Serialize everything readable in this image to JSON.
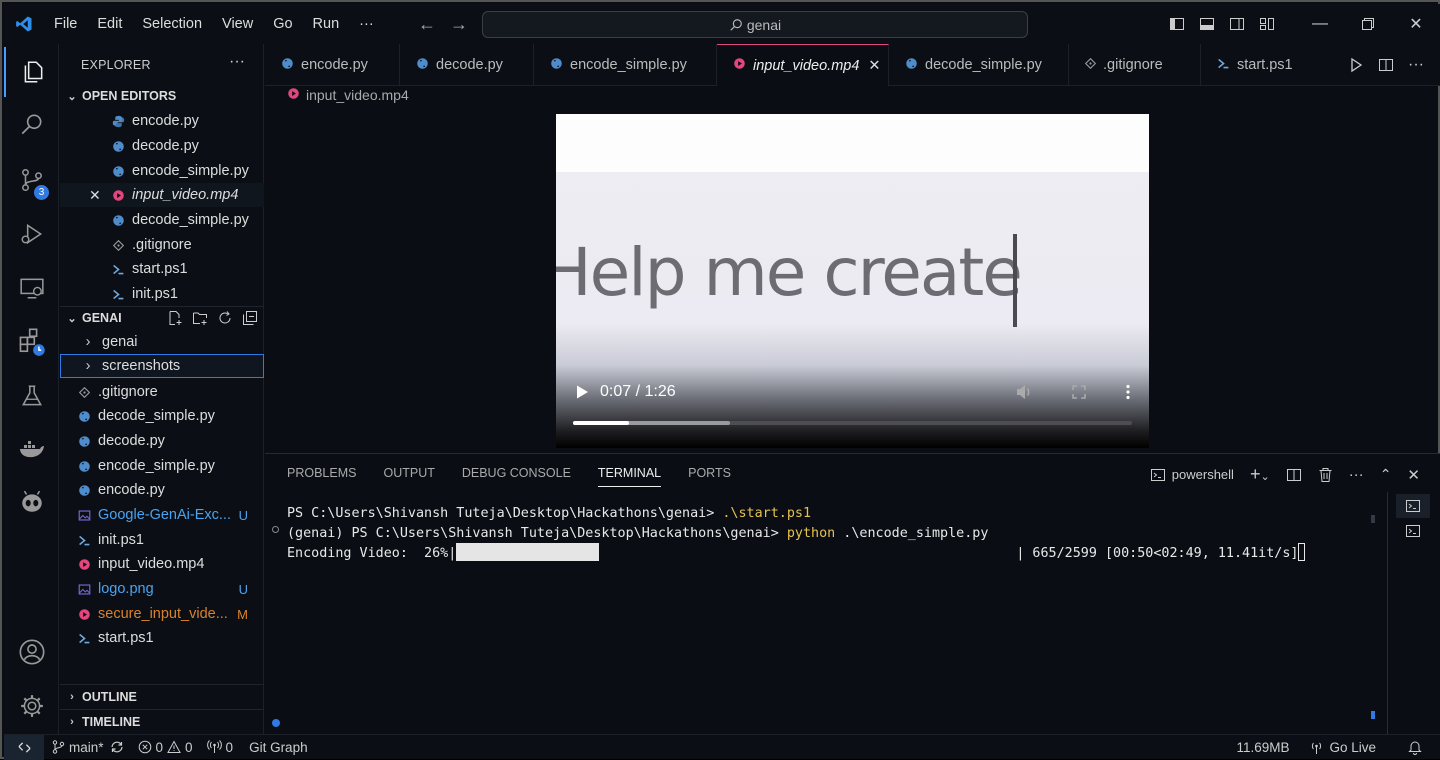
{
  "menu": [
    "File",
    "Edit",
    "Selection",
    "View",
    "Go",
    "Run",
    "···"
  ],
  "search": {
    "text": "genai"
  },
  "sidebar": {
    "title": "EXPLORER",
    "more": "···",
    "open_editors_label": "OPEN EDITORS",
    "open_editors": [
      {
        "name": "encode.py",
        "icon": "python"
      },
      {
        "name": "decode.py",
        "icon": "python"
      },
      {
        "name": "encode_simple.py",
        "icon": "python"
      },
      {
        "name": "input_video.mp4",
        "icon": "video"
      },
      {
        "name": "decode_simple.py",
        "icon": "python"
      },
      {
        "name": ".gitignore",
        "icon": "git"
      },
      {
        "name": "start.ps1",
        "icon": "powershell"
      },
      {
        "name": "init.ps1",
        "icon": "powershell"
      }
    ],
    "folder_label": "GENAI",
    "tree": [
      {
        "name": "genai",
        "type": "folder"
      },
      {
        "name": "screenshots",
        "type": "folder"
      },
      {
        "name": ".gitignore",
        "icon": "git"
      },
      {
        "name": "decode_simple.py",
        "icon": "python"
      },
      {
        "name": "decode.py",
        "icon": "python"
      },
      {
        "name": "encode_simple.py",
        "icon": "python"
      },
      {
        "name": "encode.py",
        "icon": "python"
      },
      {
        "name": "Google-GenAi-Exc...",
        "icon": "image",
        "status": "U"
      },
      {
        "name": "init.ps1",
        "icon": "powershell"
      },
      {
        "name": "input_video.mp4",
        "icon": "video"
      },
      {
        "name": "logo.png",
        "icon": "image",
        "status": "U"
      },
      {
        "name": "secure_input_vide...",
        "icon": "video",
        "status": "M"
      },
      {
        "name": "start.ps1",
        "icon": "powershell"
      }
    ],
    "outline_label": "OUTLINE",
    "timeline_label": "TIMELINE"
  },
  "activity_badge": "3",
  "tabs": [
    {
      "label": "encode.py",
      "icon": "python"
    },
    {
      "label": "decode.py",
      "icon": "python"
    },
    {
      "label": "encode_simple.py",
      "icon": "python"
    },
    {
      "label": "input_video.mp4",
      "icon": "video"
    },
    {
      "label": "decode_simple.py",
      "icon": "python"
    },
    {
      "label": ".gitignore",
      "icon": "git"
    },
    {
      "label": "start.ps1",
      "icon": "powershell"
    }
  ],
  "breadcrumb": "input_video.mp4",
  "video": {
    "overlay_text": "Help me create",
    "time": "0:07 / 1:26",
    "played_fraction": 0.1,
    "buffered_fraction": 0.28
  },
  "panel": {
    "tabs": [
      "PROBLEMS",
      "OUTPUT",
      "DEBUG CONSOLE",
      "TERMINAL",
      "PORTS"
    ],
    "shell": "powershell",
    "lines": [
      {
        "prompt": "PS C:\\Users\\Shivansh Tuteja\\Desktop\\Hackathons\\genai> ",
        "cmd": ".\\start.ps1",
        "rest": ""
      },
      {
        "prompt": "(genai) PS C:\\Users\\Shivansh Tuteja\\Desktop\\Hackathons\\genai> ",
        "cmd": "python",
        "rest": " .\\encode_simple.py"
      }
    ],
    "progress": {
      "label": "Encoding Video:  26%|",
      "percent": 26,
      "stats": "| 665/2599 [00:50<02:49, 11.41it/s]"
    }
  },
  "status": {
    "branch": "main*",
    "errors": "0",
    "warnings": "0",
    "ports": "0",
    "git_graph": "Git Graph",
    "memory": "11.69MB",
    "golive": "Go Live"
  },
  "colors": {
    "accent": "#2f7ae5",
    "python": "#4f8ccc",
    "video": "#e3467d",
    "untracked": "#4aa3f0",
    "modified": "#d9822b"
  }
}
